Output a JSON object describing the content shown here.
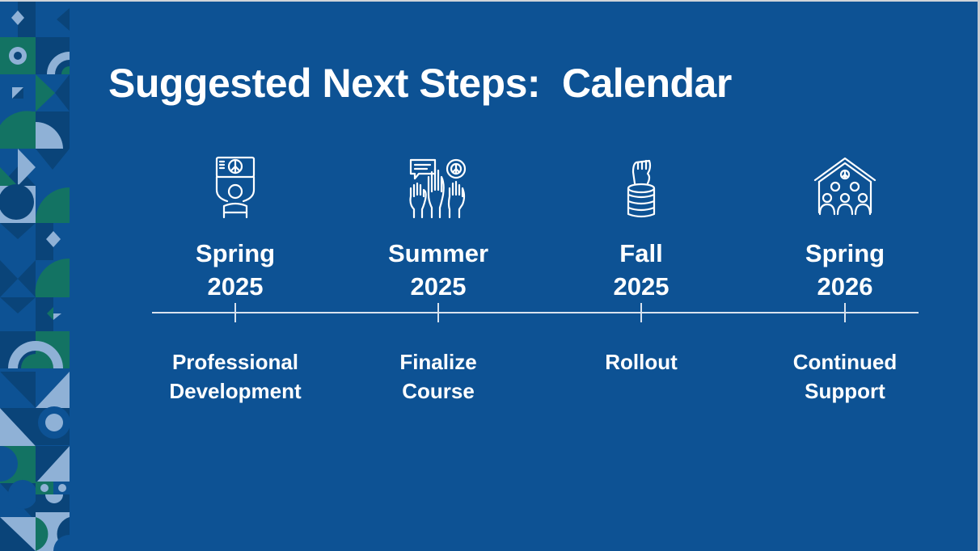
{
  "slide": {
    "title": "Suggested Next Steps:  Calendar",
    "colors": {
      "background": "#0d5294",
      "text": "#ffffff",
      "timeline": "#d8e2ee",
      "pattern_dark": "#0a4479",
      "pattern_light": "#8fb1d6",
      "pattern_green": "#137363"
    },
    "steps": [
      {
        "icon": "protester-peace-sign-icon",
        "season": "Spring",
        "year": "2025",
        "line1": "Professional",
        "line2": "Development"
      },
      {
        "icon": "raised-hands-peace-icon",
        "season": "Summer",
        "year": "2025",
        "line1": "Finalize",
        "line2": "Course"
      },
      {
        "icon": "fist-on-coins-icon",
        "season": "Fall",
        "year": "2025",
        "line1": "Rollout",
        "line2": ""
      },
      {
        "icon": "community-house-icon",
        "season": "Spring",
        "year": "2026",
        "line1": "Continued",
        "line2": "Support"
      }
    ]
  }
}
